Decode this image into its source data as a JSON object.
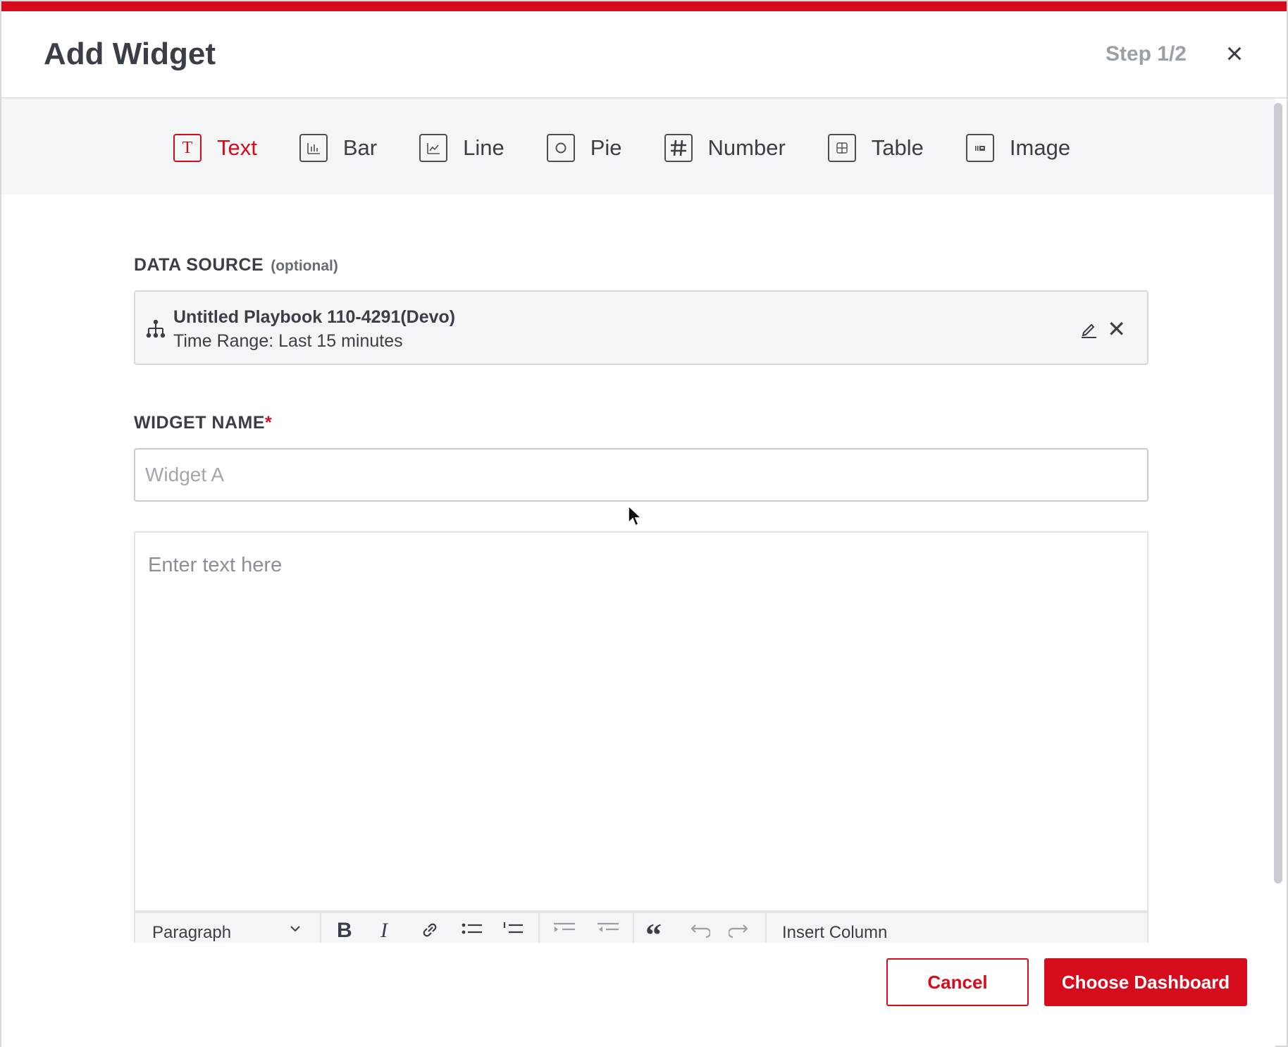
{
  "header": {
    "title": "Add Widget",
    "step": "Step 1/2",
    "close_icon": "close-icon"
  },
  "widget_types": [
    {
      "label": "Text",
      "icon": "text-icon",
      "active": true
    },
    {
      "label": "Bar",
      "icon": "bar-chart-icon",
      "active": false
    },
    {
      "label": "Line",
      "icon": "line-chart-icon",
      "active": false
    },
    {
      "label": "Pie",
      "icon": "pie-chart-icon",
      "active": false
    },
    {
      "label": "Number",
      "icon": "hash-icon",
      "active": false
    },
    {
      "label": "Table",
      "icon": "table-icon",
      "active": false
    },
    {
      "label": "Image",
      "icon": "image-icon",
      "active": false
    }
  ],
  "data_source": {
    "label": "DATA SOURCE",
    "optional": "(optional)",
    "name": "Untitled Playbook 110-4291(Devo)",
    "time_range": "Time Range: Last 15 minutes"
  },
  "widget_name": {
    "label": "WIDGET NAME",
    "required_mark": "*",
    "value": "",
    "placeholder": "Widget A"
  },
  "editor": {
    "placeholder": "Enter text here",
    "toolbar": {
      "block_format": "Paragraph",
      "insert_column": "Insert Column"
    }
  },
  "footer": {
    "cancel_label": "Cancel",
    "choose_label": "Choose Dashboard"
  },
  "colors": {
    "accent": "#d50c1c",
    "panel": "#f4f5f7",
    "text": "#3a3f47"
  }
}
